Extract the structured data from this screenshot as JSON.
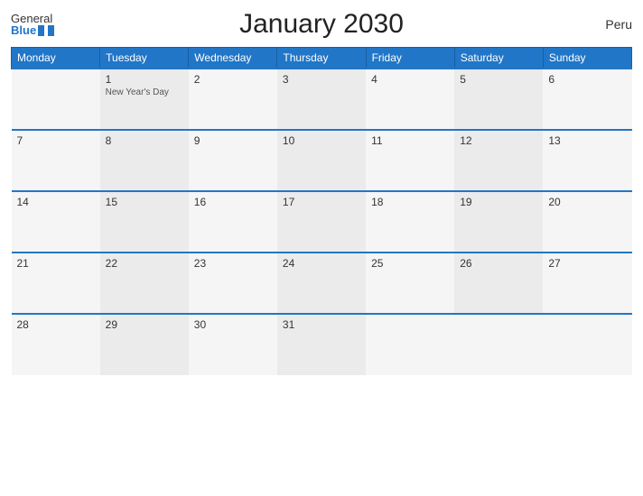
{
  "header": {
    "title": "January 2030",
    "country": "Peru",
    "logo_general": "General",
    "logo_blue": "Blue"
  },
  "weekdays": [
    "Monday",
    "Tuesday",
    "Wednesday",
    "Thursday",
    "Friday",
    "Saturday",
    "Sunday"
  ],
  "weeks": [
    [
      {
        "day": "",
        "holiday": ""
      },
      {
        "day": "1",
        "holiday": "New Year's Day"
      },
      {
        "day": "2",
        "holiday": ""
      },
      {
        "day": "3",
        "holiday": ""
      },
      {
        "day": "4",
        "holiday": ""
      },
      {
        "day": "5",
        "holiday": ""
      },
      {
        "day": "6",
        "holiday": ""
      }
    ],
    [
      {
        "day": "7",
        "holiday": ""
      },
      {
        "day": "8",
        "holiday": ""
      },
      {
        "day": "9",
        "holiday": ""
      },
      {
        "day": "10",
        "holiday": ""
      },
      {
        "day": "11",
        "holiday": ""
      },
      {
        "day": "12",
        "holiday": ""
      },
      {
        "day": "13",
        "holiday": ""
      }
    ],
    [
      {
        "day": "14",
        "holiday": ""
      },
      {
        "day": "15",
        "holiday": ""
      },
      {
        "day": "16",
        "holiday": ""
      },
      {
        "day": "17",
        "holiday": ""
      },
      {
        "day": "18",
        "holiday": ""
      },
      {
        "day": "19",
        "holiday": ""
      },
      {
        "day": "20",
        "holiday": ""
      }
    ],
    [
      {
        "day": "21",
        "holiday": ""
      },
      {
        "day": "22",
        "holiday": ""
      },
      {
        "day": "23",
        "holiday": ""
      },
      {
        "day": "24",
        "holiday": ""
      },
      {
        "day": "25",
        "holiday": ""
      },
      {
        "day": "26",
        "holiday": ""
      },
      {
        "day": "27",
        "holiday": ""
      }
    ],
    [
      {
        "day": "28",
        "holiday": ""
      },
      {
        "day": "29",
        "holiday": ""
      },
      {
        "day": "30",
        "holiday": ""
      },
      {
        "day": "31",
        "holiday": ""
      },
      {
        "day": "",
        "holiday": ""
      },
      {
        "day": "",
        "holiday": ""
      },
      {
        "day": "",
        "holiday": ""
      }
    ]
  ]
}
